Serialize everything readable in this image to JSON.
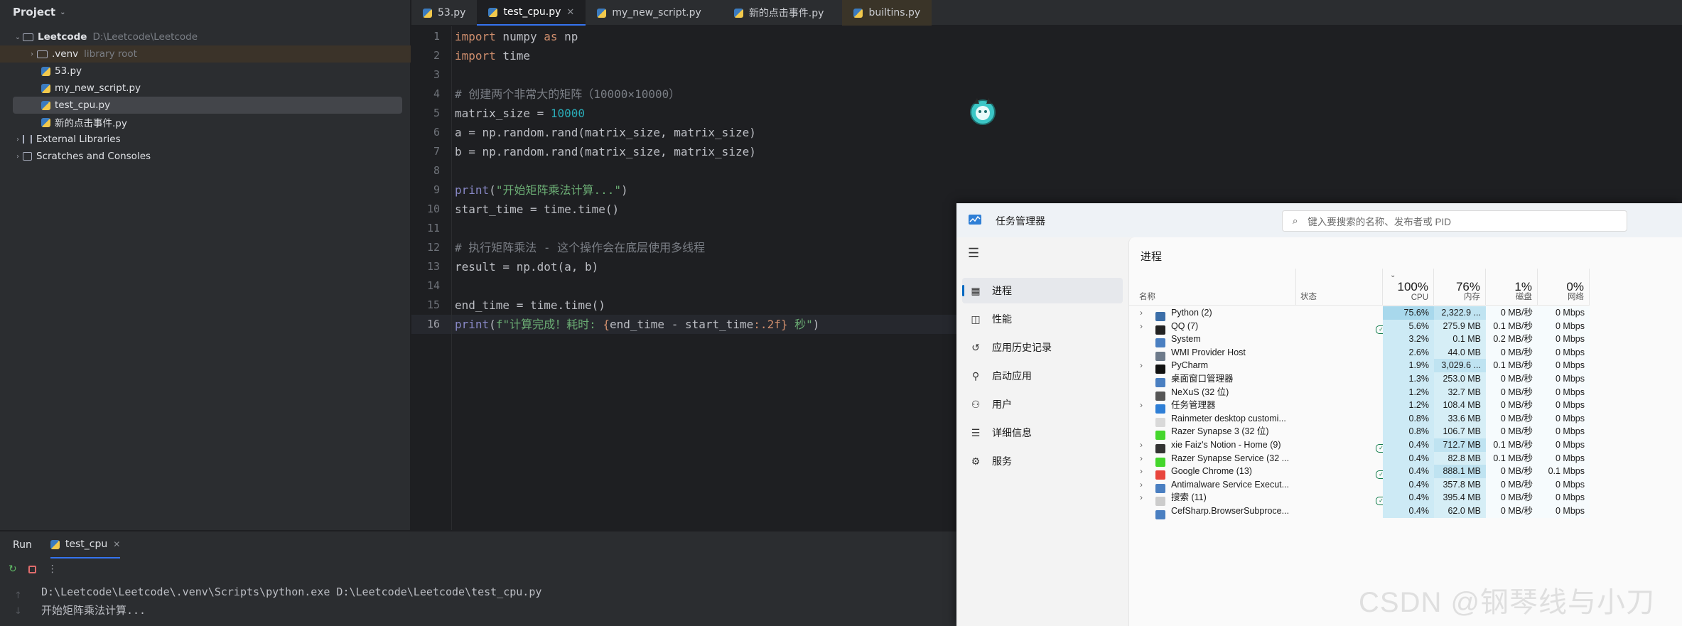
{
  "project": {
    "header": "Project",
    "root": {
      "name": "Leetcode",
      "path": "D:\\Leetcode\\Leetcode"
    },
    "items": [
      {
        "name": ".venv",
        "note": "library root"
      },
      {
        "name": "53.py"
      },
      {
        "name": "my_new_script.py"
      },
      {
        "name": "test_cpu.py"
      },
      {
        "name": "新的点击事件.py"
      }
    ],
    "external": "External Libraries",
    "scratches": "Scratches and Consoles"
  },
  "editor": {
    "tabs": [
      {
        "label": "53.py"
      },
      {
        "label": "test_cpu.py"
      },
      {
        "label": "my_new_script.py"
      },
      {
        "label": "新的点击事件.py"
      },
      {
        "label": "builtins.py"
      }
    ],
    "line_numbers": [
      "1",
      "2",
      "3",
      "4",
      "5",
      "6",
      "7",
      "8",
      "9",
      "10",
      "11",
      "12",
      "13",
      "14",
      "15",
      "16"
    ],
    "code": {
      "l1_kw1": "import",
      "l1_mod": " numpy ",
      "l1_kw2": "as",
      "l1_alias": " np",
      "l2_kw": "import",
      "l2_mod": " time",
      "l4": "# 创建两个非常大的矩阵（10000×10000）",
      "l5_var": "matrix_size = ",
      "l5_num": "10000",
      "l6": "a = np.random.rand(matrix_size, matrix_size)",
      "l7": "b = np.random.rand(matrix_size, matrix_size)",
      "l9_fn": "print",
      "l9_open": "(",
      "l9_str": "\"开始矩阵乘法计算...\"",
      "l9_close": ")",
      "l10": "start_time = time.time()",
      "l12": "# 执行矩阵乘法 - 这个操作会在底层使用多线程",
      "l13": "result = np.dot(a, b)",
      "l15": "end_time = time.time()",
      "l16_fn": "print",
      "l16_open": "(",
      "l16_str1": "f\"计算完成！耗时: ",
      "l16_br1": "{",
      "l16_expr": "end_time - start_time",
      "l16_fmt": ":.2f",
      "l16_br2": "}",
      "l16_str2": " 秒\"",
      "l16_close": ")"
    }
  },
  "run": {
    "label": "Run",
    "tab": "test_cpu",
    "console": [
      "D:\\Leetcode\\Leetcode\\.venv\\Scripts\\python.exe D:\\Leetcode\\Leetcode\\test_cpu.py",
      "开始矩阵乘法计算..."
    ]
  },
  "task_manager": {
    "title": "任务管理器",
    "search_placeholder": "键入要搜索的名称、发布者或 PID",
    "nav": [
      "进程",
      "性能",
      "应用历史记录",
      "启动应用",
      "用户",
      "详细信息",
      "服务"
    ],
    "page_title": "进程",
    "columns": {
      "name": "名称",
      "status": "状态",
      "cpu_pct": "100%",
      "cpu": "CPU",
      "mem_pct": "76%",
      "mem": "内存",
      "disk_pct": "1%",
      "disk": "磁盘",
      "net_pct": "0%",
      "net": "网络"
    },
    "processes": [
      {
        "name": "Python (2)",
        "cpu": "75.6%",
        "mem": "2,322.9 ...",
        "disk": "0 MB/秒",
        "net": "0 Mbps",
        "expand": true,
        "eco": false,
        "icon": "#3b6ea8"
      },
      {
        "name": "QQ (7)",
        "cpu": "5.6%",
        "mem": "275.9 MB",
        "disk": "0.1 MB/秒",
        "net": "0 Mbps",
        "expand": true,
        "eco": true,
        "icon": "#222222"
      },
      {
        "name": "System",
        "cpu": "3.2%",
        "mem": "0.1 MB",
        "disk": "0.2 MB/秒",
        "net": "0 Mbps",
        "expand": false,
        "eco": false,
        "icon": "#4a7fc1"
      },
      {
        "name": "WMI Provider Host",
        "cpu": "2.6%",
        "mem": "44.0 MB",
        "disk": "0 MB/秒",
        "net": "0 Mbps",
        "expand": false,
        "eco": false,
        "icon": "#6d7a8a"
      },
      {
        "name": "PyCharm",
        "cpu": "1.9%",
        "mem": "3,029.6 ...",
        "disk": "0.1 MB/秒",
        "net": "0 Mbps",
        "expand": true,
        "eco": false,
        "icon": "#111111"
      },
      {
        "name": "桌面窗口管理器",
        "cpu": "1.3%",
        "mem": "253.0 MB",
        "disk": "0 MB/秒",
        "net": "0 Mbps",
        "expand": false,
        "eco": false,
        "icon": "#4a7fc1"
      },
      {
        "name": "NeXuS (32 位)",
        "cpu": "1.2%",
        "mem": "32.7 MB",
        "disk": "0 MB/秒",
        "net": "0 Mbps",
        "expand": false,
        "eco": false,
        "icon": "#555555"
      },
      {
        "name": "任务管理器",
        "cpu": "1.2%",
        "mem": "108.4 MB",
        "disk": "0 MB/秒",
        "net": "0 Mbps",
        "expand": true,
        "eco": false,
        "icon": "#2f7fd6"
      },
      {
        "name": "Rainmeter desktop customi...",
        "cpu": "0.8%",
        "mem": "33.6 MB",
        "disk": "0 MB/秒",
        "net": "0 Mbps",
        "expand": false,
        "eco": false,
        "icon": "#d9d9d9"
      },
      {
        "name": "Razer Synapse 3 (32 位)",
        "cpu": "0.8%",
        "mem": "106.7 MB",
        "disk": "0 MB/秒",
        "net": "0 Mbps",
        "expand": false,
        "eco": false,
        "icon": "#44d62c"
      },
      {
        "name": "xie Faiz's Notion - Home (9)",
        "cpu": "0.4%",
        "mem": "712.7 MB",
        "disk": "0.1 MB/秒",
        "net": "0 Mbps",
        "expand": true,
        "eco": true,
        "icon": "#333333"
      },
      {
        "name": "Razer Synapse Service (32 ...",
        "cpu": "0.4%",
        "mem": "82.8 MB",
        "disk": "0.1 MB/秒",
        "net": "0 Mbps",
        "expand": true,
        "eco": false,
        "icon": "#44d62c"
      },
      {
        "name": "Google Chrome (13)",
        "cpu": "0.4%",
        "mem": "888.1 MB",
        "disk": "0 MB/秒",
        "net": "0.1 Mbps",
        "expand": true,
        "eco": true,
        "icon": "#e8453c"
      },
      {
        "name": "Antimalware Service Execut...",
        "cpu": "0.4%",
        "mem": "357.8 MB",
        "disk": "0 MB/秒",
        "net": "0 Mbps",
        "expand": true,
        "eco": false,
        "icon": "#4a7fc1"
      },
      {
        "name": "搜索 (11)",
        "cpu": "0.4%",
        "mem": "395.4 MB",
        "disk": "0 MB/秒",
        "net": "0 Mbps",
        "expand": true,
        "eco": true,
        "icon": "#cccccc"
      },
      {
        "name": "CefSharp.BrowserSubproce...",
        "cpu": "0.4%",
        "mem": "62.0 MB",
        "disk": "0 MB/秒",
        "net": "0 Mbps",
        "expand": false,
        "eco": false,
        "icon": "#4a7fc1"
      }
    ]
  },
  "watermark": "CSDN @钢琴线与小刀",
  "colors": {
    "accent": "#3574f0",
    "cpu_heat": "#cdeaf5",
    "cpu_hot": "#a8d8ec",
    "mem_heat": "#d6eef6"
  }
}
